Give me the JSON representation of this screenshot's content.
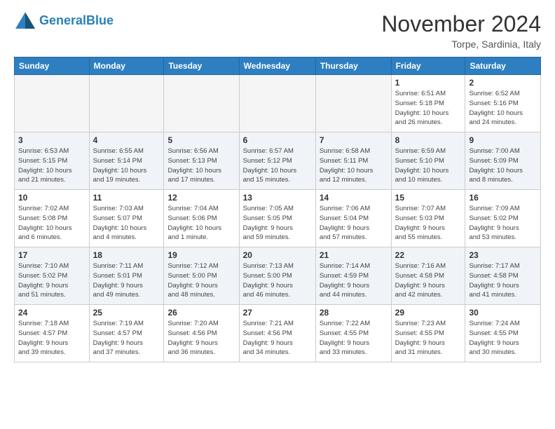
{
  "header": {
    "logo_line1": "General",
    "logo_line2": "Blue",
    "month": "November 2024",
    "location": "Torpe, Sardinia, Italy"
  },
  "days_of_week": [
    "Sunday",
    "Monday",
    "Tuesday",
    "Wednesday",
    "Thursday",
    "Friday",
    "Saturday"
  ],
  "weeks": [
    [
      {
        "day": "",
        "empty": true
      },
      {
        "day": "",
        "empty": true
      },
      {
        "day": "",
        "empty": true
      },
      {
        "day": "",
        "empty": true
      },
      {
        "day": "",
        "empty": true
      },
      {
        "day": "1",
        "info": "Sunrise: 6:51 AM\nSunset: 5:18 PM\nDaylight: 10 hours\nand 26 minutes."
      },
      {
        "day": "2",
        "info": "Sunrise: 6:52 AM\nSunset: 5:16 PM\nDaylight: 10 hours\nand 24 minutes."
      }
    ],
    [
      {
        "day": "3",
        "info": "Sunrise: 6:53 AM\nSunset: 5:15 PM\nDaylight: 10 hours\nand 21 minutes."
      },
      {
        "day": "4",
        "info": "Sunrise: 6:55 AM\nSunset: 5:14 PM\nDaylight: 10 hours\nand 19 minutes."
      },
      {
        "day": "5",
        "info": "Sunrise: 6:56 AM\nSunset: 5:13 PM\nDaylight: 10 hours\nand 17 minutes."
      },
      {
        "day": "6",
        "info": "Sunrise: 6:57 AM\nSunset: 5:12 PM\nDaylight: 10 hours\nand 15 minutes."
      },
      {
        "day": "7",
        "info": "Sunrise: 6:58 AM\nSunset: 5:11 PM\nDaylight: 10 hours\nand 12 minutes."
      },
      {
        "day": "8",
        "info": "Sunrise: 6:59 AM\nSunset: 5:10 PM\nDaylight: 10 hours\nand 10 minutes."
      },
      {
        "day": "9",
        "info": "Sunrise: 7:00 AM\nSunset: 5:09 PM\nDaylight: 10 hours\nand 8 minutes."
      }
    ],
    [
      {
        "day": "10",
        "info": "Sunrise: 7:02 AM\nSunset: 5:08 PM\nDaylight: 10 hours\nand 6 minutes."
      },
      {
        "day": "11",
        "info": "Sunrise: 7:03 AM\nSunset: 5:07 PM\nDaylight: 10 hours\nand 4 minutes."
      },
      {
        "day": "12",
        "info": "Sunrise: 7:04 AM\nSunset: 5:06 PM\nDaylight: 10 hours\nand 1 minute."
      },
      {
        "day": "13",
        "info": "Sunrise: 7:05 AM\nSunset: 5:05 PM\nDaylight: 9 hours\nand 59 minutes."
      },
      {
        "day": "14",
        "info": "Sunrise: 7:06 AM\nSunset: 5:04 PM\nDaylight: 9 hours\nand 57 minutes."
      },
      {
        "day": "15",
        "info": "Sunrise: 7:07 AM\nSunset: 5:03 PM\nDaylight: 9 hours\nand 55 minutes."
      },
      {
        "day": "16",
        "info": "Sunrise: 7:09 AM\nSunset: 5:02 PM\nDaylight: 9 hours\nand 53 minutes."
      }
    ],
    [
      {
        "day": "17",
        "info": "Sunrise: 7:10 AM\nSunset: 5:02 PM\nDaylight: 9 hours\nand 51 minutes."
      },
      {
        "day": "18",
        "info": "Sunrise: 7:11 AM\nSunset: 5:01 PM\nDaylight: 9 hours\nand 49 minutes."
      },
      {
        "day": "19",
        "info": "Sunrise: 7:12 AM\nSunset: 5:00 PM\nDaylight: 9 hours\nand 48 minutes."
      },
      {
        "day": "20",
        "info": "Sunrise: 7:13 AM\nSunset: 5:00 PM\nDaylight: 9 hours\nand 46 minutes."
      },
      {
        "day": "21",
        "info": "Sunrise: 7:14 AM\nSunset: 4:59 PM\nDaylight: 9 hours\nand 44 minutes."
      },
      {
        "day": "22",
        "info": "Sunrise: 7:16 AM\nSunset: 4:58 PM\nDaylight: 9 hours\nand 42 minutes."
      },
      {
        "day": "23",
        "info": "Sunrise: 7:17 AM\nSunset: 4:58 PM\nDaylight: 9 hours\nand 41 minutes."
      }
    ],
    [
      {
        "day": "24",
        "info": "Sunrise: 7:18 AM\nSunset: 4:57 PM\nDaylight: 9 hours\nand 39 minutes."
      },
      {
        "day": "25",
        "info": "Sunrise: 7:19 AM\nSunset: 4:57 PM\nDaylight: 9 hours\nand 37 minutes."
      },
      {
        "day": "26",
        "info": "Sunrise: 7:20 AM\nSunset: 4:56 PM\nDaylight: 9 hours\nand 36 minutes."
      },
      {
        "day": "27",
        "info": "Sunrise: 7:21 AM\nSunset: 4:56 PM\nDaylight: 9 hours\nand 34 minutes."
      },
      {
        "day": "28",
        "info": "Sunrise: 7:22 AM\nSunset: 4:55 PM\nDaylight: 9 hours\nand 33 minutes."
      },
      {
        "day": "29",
        "info": "Sunrise: 7:23 AM\nSunset: 4:55 PM\nDaylight: 9 hours\nand 31 minutes."
      },
      {
        "day": "30",
        "info": "Sunrise: 7:24 AM\nSunset: 4:55 PM\nDaylight: 9 hours\nand 30 minutes."
      }
    ]
  ]
}
